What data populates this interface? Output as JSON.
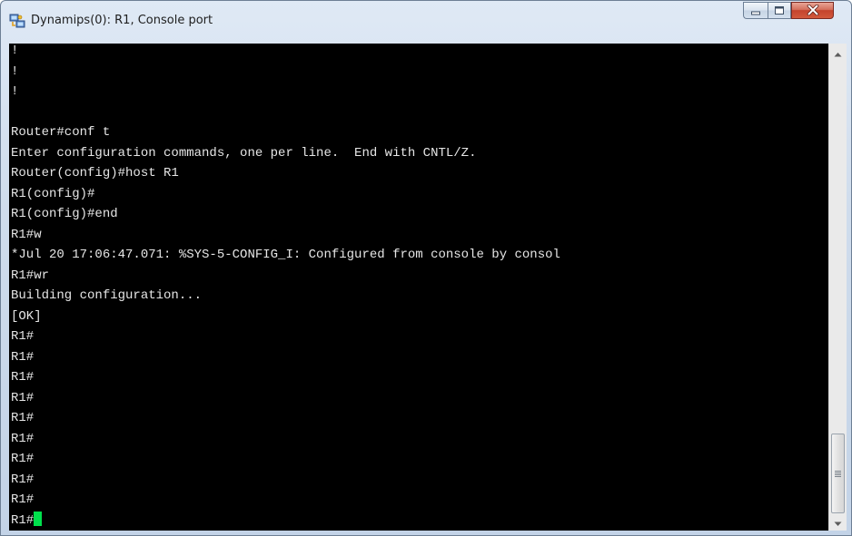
{
  "window": {
    "title": "Dynamips(0): R1, Console port",
    "icon": "network-connection-icon",
    "controls": {
      "minimize_icon": "minimize-icon",
      "maximize_icon": "maximize-icon",
      "close_icon": "close-icon"
    }
  },
  "console": {
    "background": "#000000",
    "text_color": "#e6e6e6",
    "cursor_color": "#00e04c",
    "lines": [
      "!",
      "!",
      "!",
      "",
      "Router#conf t",
      "Enter configuration commands, one per line.  End with CNTL/Z.",
      "Router(config)#host R1",
      "R1(config)#",
      "R1(config)#end",
      "R1#w",
      "*Jul 20 17:06:47.071: %SYS-5-CONFIG_I: Configured from console by consol",
      "R1#wr",
      "Building configuration...",
      "[OK]",
      "R1#",
      "R1#",
      "R1#",
      "R1#",
      "R1#",
      "R1#",
      "R1#",
      "R1#",
      "R1#"
    ],
    "prompt_line": "R1#"
  },
  "scrollbar": {
    "position": 1.0,
    "up_icon": "scroll-up-arrow-icon",
    "down_icon": "scroll-down-arrow-icon"
  }
}
